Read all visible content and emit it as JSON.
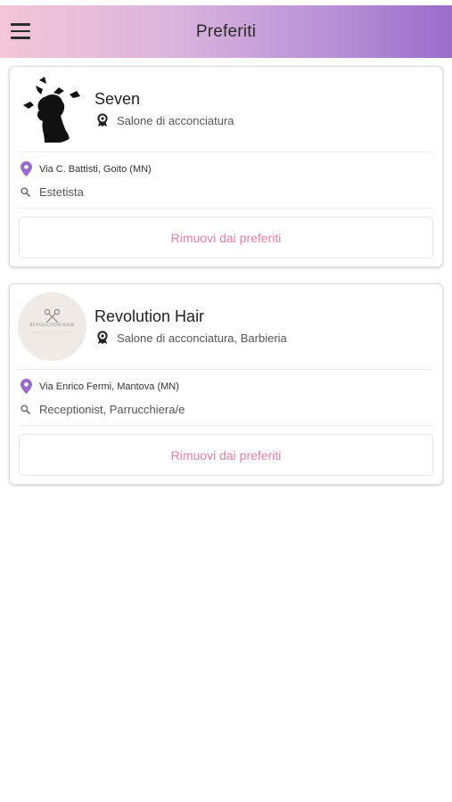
{
  "header": {
    "title": "Preferiti",
    "menu_icon": "hamburger-menu-icon"
  },
  "favorites": [
    {
      "name": "Seven",
      "category": "Salone di acconciatura",
      "address": "Via C. Battisti, Goito (MN)",
      "roles": "Estetista",
      "remove_label": "Rimuovi dai preferiti",
      "logo_icon": "silhouette-logo"
    },
    {
      "name": "Revolution Hair",
      "category": "Salone di acconciatura, Barbieria",
      "address": "Via Enrico Fermi, Mantova (MN)",
      "roles": "Receptionist, Parrucchiera/e",
      "remove_label": "Rimuovi dai preferiti",
      "logo_icon": "scissors-logo",
      "logo_text": "REVOLUTION HAIR"
    }
  ],
  "colors": {
    "accent_pink": "#e27ea6",
    "pin_purple": "#9b6cc9",
    "header_start": "#f3c6d6",
    "header_end": "#9a6cc9"
  }
}
